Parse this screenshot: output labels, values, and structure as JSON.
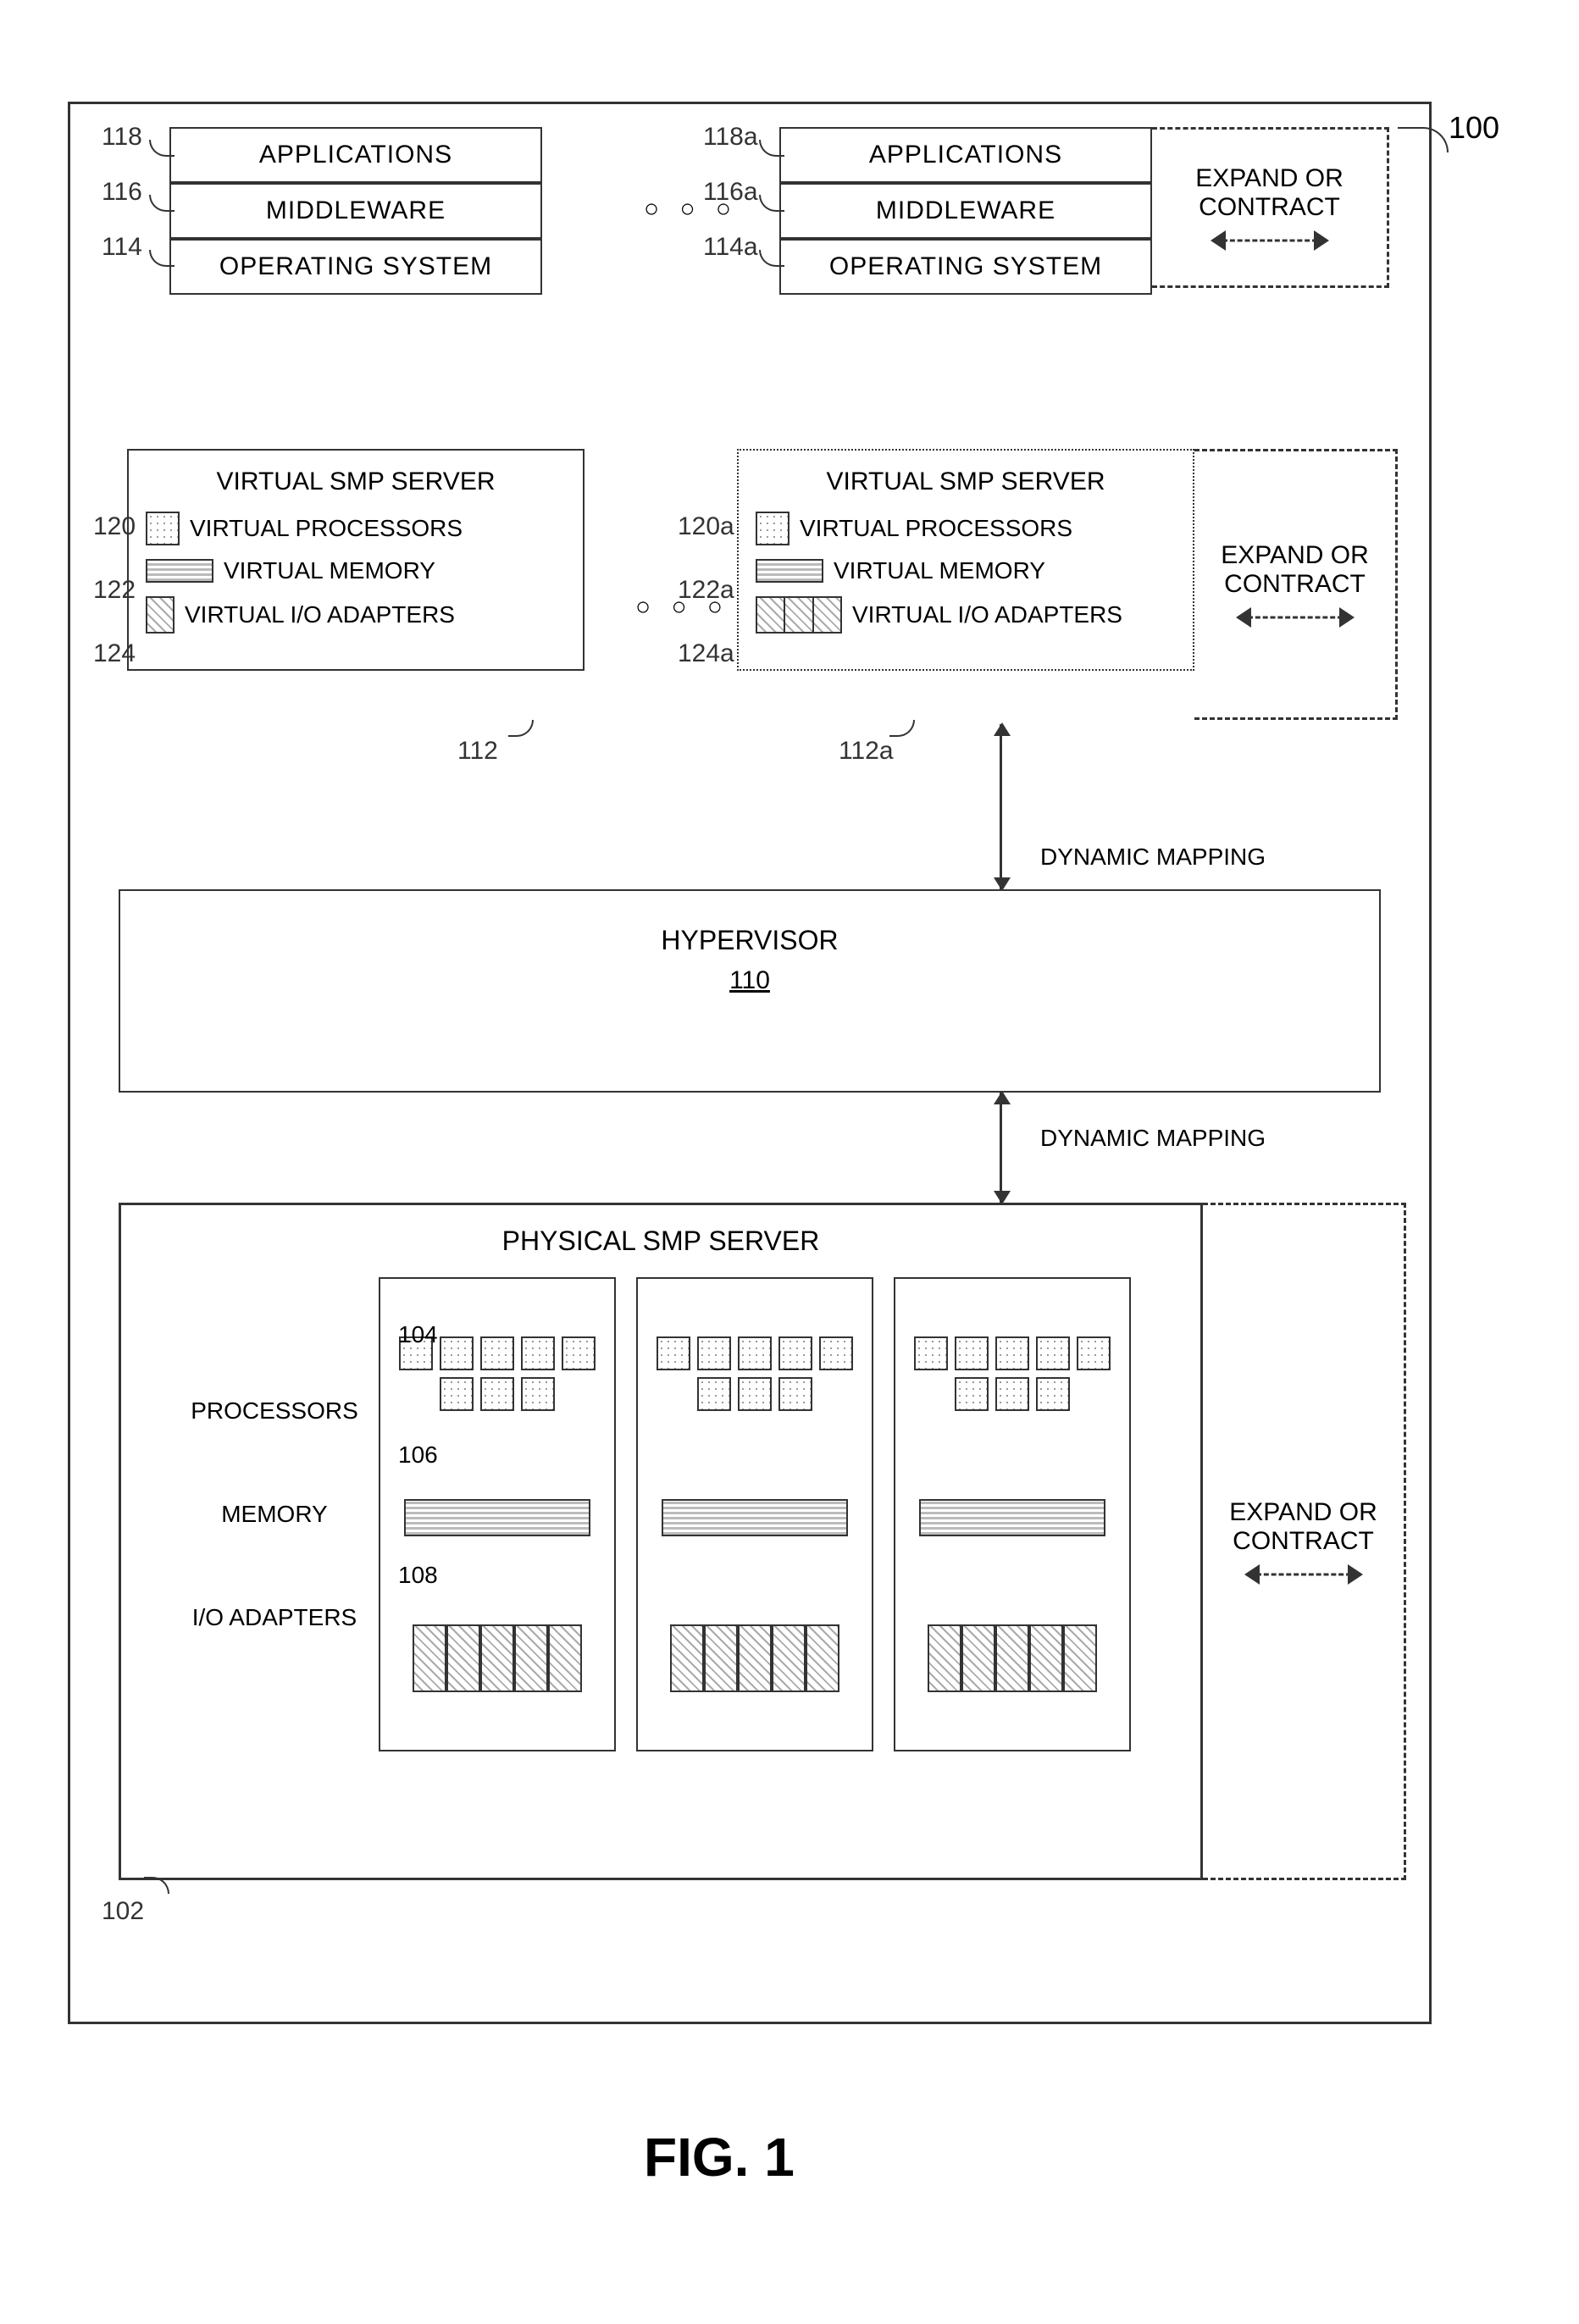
{
  "figure_label": "FIG. 1",
  "ref_100": "100",
  "software_stack": {
    "applications": "APPLICATIONS",
    "middleware": "MIDDLEWARE",
    "operating_system": "OPERATING SYSTEM",
    "refs_left": {
      "apps": "118",
      "mw": "116",
      "os": "114"
    },
    "refs_right": {
      "apps": "118a",
      "mw": "116a",
      "os": "114a"
    }
  },
  "expand_contract": {
    "line1": "EXPAND OR",
    "line2": "CONTRACT"
  },
  "virtual_server": {
    "title": "VIRTUAL SMP SERVER",
    "rows": {
      "procs": "VIRTUAL PROCESSORS",
      "mem": "VIRTUAL MEMORY",
      "io": "VIRTUAL I/O ADAPTERS"
    },
    "refs_left": {
      "box": "112",
      "procs": "120",
      "mem": "122",
      "io": "124"
    },
    "refs_right": {
      "box": "112a",
      "procs": "120a",
      "mem": "122a",
      "io": "124a"
    }
  },
  "hypervisor": {
    "label": "HYPERVISOR",
    "ref": "110"
  },
  "dynamic_mapping": "DYNAMIC MAPPING",
  "physical_server": {
    "title": "PHYSICAL SMP SERVER",
    "labels": {
      "procs": "PROCESSORS",
      "mem": "MEMORY",
      "io": "I/O ADAPTERS"
    },
    "ref_box": "102",
    "refs": {
      "procs": "104",
      "mem": "106",
      "io": "108"
    }
  },
  "chart_data": {
    "type": "diagram",
    "title": "FIG. 1",
    "nodes": [
      {
        "id": "100",
        "label": "System (outer frame)"
      },
      {
        "id": "118",
        "label": "APPLICATIONS (instance 1)"
      },
      {
        "id": "116",
        "label": "MIDDLEWARE (instance 1)"
      },
      {
        "id": "114",
        "label": "OPERATING SYSTEM (instance 1)"
      },
      {
        "id": "118a",
        "label": "APPLICATIONS (instance N)"
      },
      {
        "id": "116a",
        "label": "MIDDLEWARE (instance N)"
      },
      {
        "id": "114a",
        "label": "OPERATING SYSTEM (instance N)"
      },
      {
        "id": "112",
        "label": "VIRTUAL SMP SERVER (instance 1)"
      },
      {
        "id": "120",
        "label": "VIRTUAL PROCESSORS (in 112)"
      },
      {
        "id": "122",
        "label": "VIRTUAL MEMORY (in 112)"
      },
      {
        "id": "124",
        "label": "VIRTUAL I/O ADAPTERS (in 112)"
      },
      {
        "id": "112a",
        "label": "VIRTUAL SMP SERVER (instance N)"
      },
      {
        "id": "120a",
        "label": "VIRTUAL PROCESSORS (in 112a)"
      },
      {
        "id": "122a",
        "label": "VIRTUAL MEMORY (in 112a)"
      },
      {
        "id": "124a",
        "label": "VIRTUAL I/O ADAPTERS (in 112a)"
      },
      {
        "id": "110",
        "label": "HYPERVISOR"
      },
      {
        "id": "102",
        "label": "PHYSICAL SMP SERVER"
      },
      {
        "id": "104",
        "label": "PROCESSORS (physical)"
      },
      {
        "id": "106",
        "label": "MEMORY (physical)"
      },
      {
        "id": "108",
        "label": "I/O ADAPTERS (physical)"
      }
    ],
    "edges": [
      {
        "from": "118",
        "to": "116",
        "label": ""
      },
      {
        "from": "116",
        "to": "114",
        "label": ""
      },
      {
        "from": "118a",
        "to": "116a",
        "label": ""
      },
      {
        "from": "116a",
        "to": "114a",
        "label": ""
      },
      {
        "from": "114",
        "to": "112",
        "label": ""
      },
      {
        "from": "114a",
        "to": "112a",
        "label": ""
      },
      {
        "from": "112",
        "to": "110",
        "label": ""
      },
      {
        "from": "112a",
        "to": "110",
        "label": "DYNAMIC MAPPING"
      },
      {
        "from": "110",
        "to": "102",
        "label": "DYNAMIC MAPPING"
      },
      {
        "from": "104",
        "to": "102",
        "label": "contained-in"
      },
      {
        "from": "106",
        "to": "102",
        "label": "contained-in"
      },
      {
        "from": "108",
        "to": "102",
        "label": "contained-in"
      }
    ],
    "annotations": [
      {
        "text": "EXPAND OR CONTRACT",
        "applies_to": [
          "software_stack_right",
          "112a",
          "102"
        ]
      }
    ]
  }
}
